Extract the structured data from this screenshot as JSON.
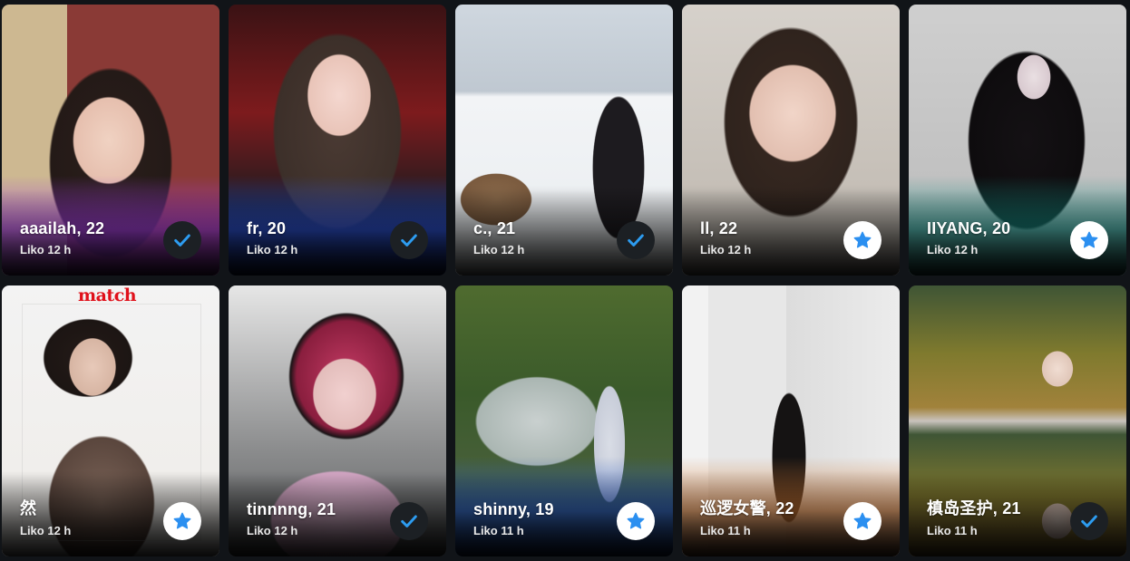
{
  "colors": {
    "page_background": "#111418",
    "check_badge_bg": "#1c2024",
    "check_color": "#2d9cf0",
    "star_badge_bg": "#ffffff",
    "star_color": "#2b8ff0",
    "overlay_text": "#e0101a"
  },
  "cards": [
    {
      "name": "aaailah, 22",
      "liko": "Liko 12 h",
      "badge": "check-icon"
    },
    {
      "name": "fr, 20",
      "liko": "Liko 12 h",
      "badge": "check-icon"
    },
    {
      "name": "c., 21",
      "liko": "Liko 12 h",
      "badge": "check-icon"
    },
    {
      "name": "ll, 22",
      "liko": "Liko 12 h",
      "badge": "star-icon"
    },
    {
      "name": "IIYANG, 20",
      "liko": "Liko 12 h",
      "badge": "star-icon"
    },
    {
      "name": "然",
      "liko": "Liko 12 h",
      "badge": "star-icon",
      "overlay": "match"
    },
    {
      "name": "tinnnng, 21",
      "liko": "Liko 12 h",
      "badge": "check-icon"
    },
    {
      "name": "shinny, 19",
      "liko": "Liko 11 h",
      "badge": "star-icon"
    },
    {
      "name": "巡逻女警, 22",
      "liko": "Liko 11 h",
      "badge": "star-icon"
    },
    {
      "name": "槙岛圣护, 21",
      "liko": "Liko 11 h",
      "badge": "check-icon"
    }
  ]
}
